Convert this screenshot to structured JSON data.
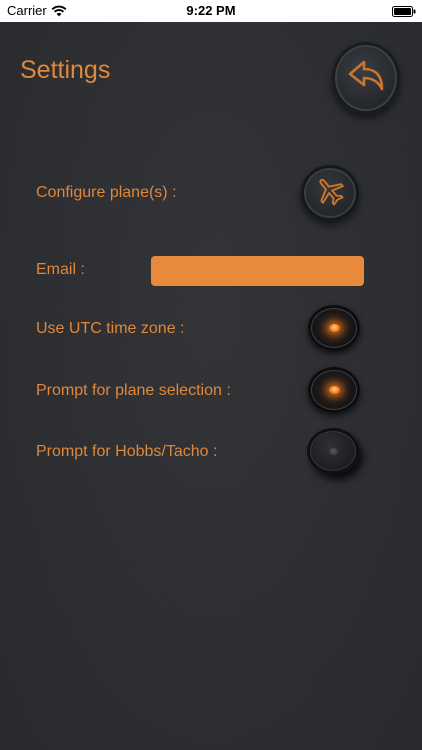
{
  "status_bar": {
    "carrier": "Carrier",
    "time": "9:22 PM",
    "wifi_icon": "wifi-icon",
    "battery_icon": "battery-icon"
  },
  "header": {
    "title": "Settings",
    "back_icon": "back-arrow-icon"
  },
  "settings": {
    "configure_planes": {
      "label": "Configure plane(s)  :",
      "icon": "airplane-icon"
    },
    "email": {
      "label": "Email :",
      "value": "",
      "placeholder": ""
    },
    "use_utc": {
      "label": "Use UTC time zone :",
      "state": "on"
    },
    "prompt_plane": {
      "label": "Prompt for plane selection :",
      "state": "on"
    },
    "prompt_hobbs": {
      "label": "Prompt for Hobbs/Tacho :",
      "state": "off"
    }
  },
  "colors": {
    "accent": "#e0873a",
    "background": "#2b2d31",
    "input_fill": "#e8893c",
    "led_on": "#ff8c28"
  }
}
